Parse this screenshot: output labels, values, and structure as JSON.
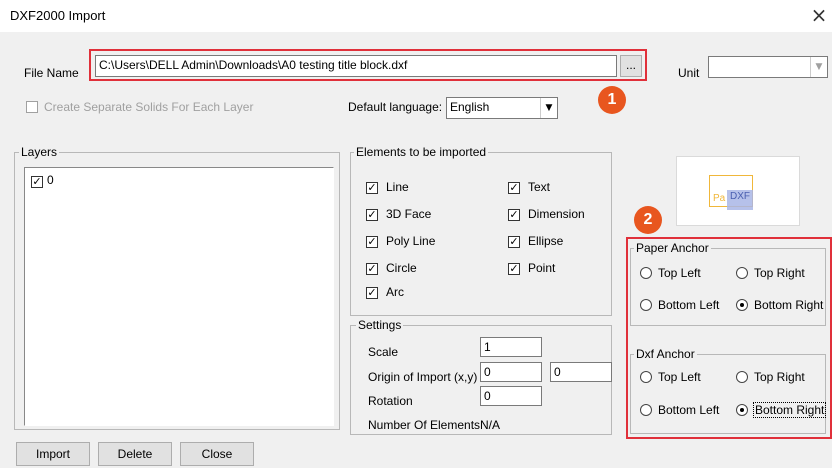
{
  "window": {
    "title": "DXF2000 Import",
    "close_glyph": "×"
  },
  "file_name": {
    "label": "File Name",
    "value": "C:\\Users\\DELL Admin\\Downloads\\A0 testing title block.dxf",
    "browse_label": "..."
  },
  "unit": {
    "label": "Unit",
    "value": ""
  },
  "separate_solids": {
    "label": "Create Separate Solids For Each Layer",
    "checked": false
  },
  "default_language": {
    "label": "Default language:",
    "value": "English"
  },
  "layers": {
    "title": "Layers",
    "items": [
      {
        "name": "0",
        "checked": true
      }
    ]
  },
  "elements": {
    "title": "Elements to be imported",
    "left": [
      {
        "label": "Line",
        "checked": true
      },
      {
        "label": "3D Face",
        "checked": true
      },
      {
        "label": "Poly Line",
        "checked": true
      },
      {
        "label": "Circle",
        "checked": true
      },
      {
        "label": "Arc",
        "checked": true
      }
    ],
    "right": [
      {
        "label": "Text",
        "checked": true
      },
      {
        "label": "Dimension",
        "checked": true
      },
      {
        "label": "Ellipse",
        "checked": true
      },
      {
        "label": "Point",
        "checked": true
      }
    ]
  },
  "settings": {
    "title": "Settings",
    "scale_label": "Scale",
    "scale_value": "1",
    "origin_label": "Origin of Import (x,y)",
    "origin_x": "0",
    "origin_y": "0",
    "rotation_label": "Rotation",
    "rotation_value": "0",
    "count_label": "Number Of Elements",
    "count_value": "N/A"
  },
  "preview": {
    "text_pa": "Pa",
    "text_dxf": "DXF"
  },
  "paper_anchor": {
    "title": "Paper Anchor",
    "options": [
      "Top Left",
      "Top Right",
      "Bottom Left",
      "Bottom Right"
    ],
    "selected": "Bottom Right"
  },
  "dxf_anchor": {
    "title": "Dxf Anchor",
    "options": [
      "Top Left",
      "Top Right",
      "Bottom Left",
      "Bottom Right"
    ],
    "selected": "Bottom Right"
  },
  "buttons": {
    "import": "Import",
    "delete": "Delete",
    "close": "Close"
  },
  "badges": [
    "1",
    "2"
  ],
  "colors": {
    "highlight": "#e0303a",
    "badge": "#e8561f",
    "preview_box": "#f0b73a",
    "preview_dxf": "#a9b6e6"
  }
}
